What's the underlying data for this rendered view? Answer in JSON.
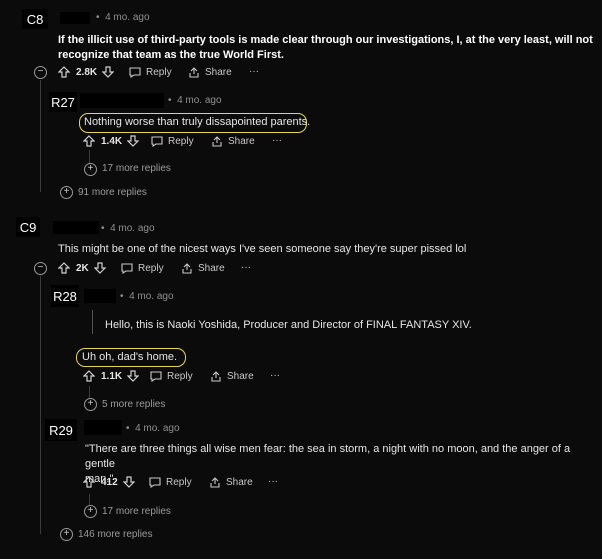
{
  "c8": {
    "tag": "C8",
    "time": "4 mo. ago",
    "text_line1": "If the illicit use of third-party tools is made clear through our investigations, I, at the very least, will not",
    "text_line2": "recognize that team as the true World First.",
    "votes": "2.8K",
    "reply": "Reply",
    "share": "Share",
    "more": "···",
    "more_replies": "91 more replies",
    "r27": {
      "tag": "R27",
      "time": "4 mo. ago",
      "text": "Nothing worse than truly dissapointed parents.",
      "votes": "1.4K",
      "reply": "Reply",
      "share": "Share",
      "more": "···",
      "more_replies": "17 more replies"
    }
  },
  "c9": {
    "tag": "C9",
    "time": "4 mo. ago",
    "text": "This might be one of the nicest ways I've seen someone say they're super pissed lol",
    "votes": "2K",
    "reply": "Reply",
    "share": "Share",
    "more": "···",
    "more_replies": "146 more replies",
    "r28": {
      "tag": "R28",
      "time": "4 mo. ago",
      "quote": "Hello, this is Naoki Yoshida, Producer and Director of FINAL FANTASY XIV.",
      "text": "Uh oh, dad's home.",
      "votes": "1.1K",
      "reply": "Reply",
      "share": "Share",
      "more": "···",
      "more_replies": "5 more replies"
    },
    "r29": {
      "tag": "R29",
      "time": "4 mo. ago",
      "text_line1": "\"There are three things all wise men fear: the sea in storm, a night with no moon, and the anger of a gentle",
      "text_line2": "man.\"",
      "votes": "412",
      "reply": "Reply",
      "share": "Share",
      "more": "···",
      "more_replies": "17 more replies"
    }
  },
  "colors": {
    "background": "#0b0b0b",
    "highlight": "#e7d84a",
    "thread_line": "#3a3a3a"
  },
  "icons": [
    "upvote-icon",
    "downvote-icon",
    "reply-icon",
    "share-icon",
    "collapse-icon",
    "expand-icon"
  ]
}
